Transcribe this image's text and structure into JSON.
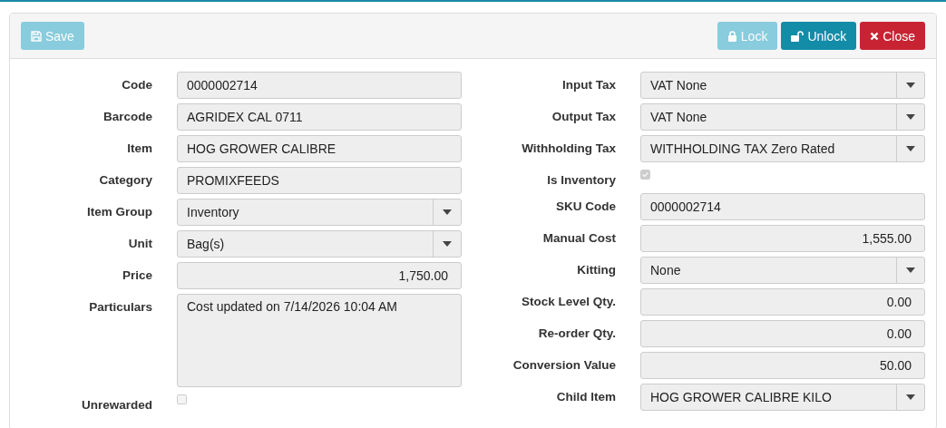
{
  "toolbar": {
    "left_buttons": [
      {
        "label": "Save",
        "kind": "save",
        "disabled": true
      }
    ],
    "right_buttons": [
      {
        "label": "Lock",
        "kind": "lock",
        "disabled": true
      },
      {
        "label": "Unlock",
        "kind": "unlock",
        "disabled": false
      },
      {
        "label": "Close",
        "kind": "close",
        "disabled": false
      }
    ]
  },
  "left_fields": [
    {
      "label": "Code",
      "kind": "text",
      "value": "0000002714"
    },
    {
      "label": "Barcode",
      "kind": "text",
      "value": "AGRIDEX CAL 0711"
    },
    {
      "label": "Item",
      "kind": "text",
      "value": "HOG GROWER CALIBRE"
    },
    {
      "label": "Category",
      "kind": "text",
      "value": "PROMIXFEEDS"
    },
    {
      "label": "Item Group",
      "kind": "select",
      "value": "Inventory"
    },
    {
      "label": "Unit",
      "kind": "select",
      "value": "Bag(s)"
    },
    {
      "label": "Price",
      "kind": "number",
      "value": "1,750.00"
    },
    {
      "label": "Particulars",
      "kind": "textarea",
      "value": "Cost updated on 7/14/2026 10:04 AM"
    },
    {
      "label": "Unrewarded",
      "kind": "checkbox",
      "checked": false
    }
  ],
  "right_fields": [
    {
      "label": "Input Tax",
      "kind": "select",
      "value": "VAT None"
    },
    {
      "label": "Output Tax",
      "kind": "select",
      "value": "VAT None"
    },
    {
      "label": "Withholding Tax",
      "kind": "select",
      "value": "WITHHOLDING TAX Zero Rated"
    },
    {
      "label": "Is Inventory",
      "kind": "checkbox",
      "checked": true
    },
    {
      "label": "SKU Code",
      "kind": "text",
      "value": "0000002714"
    },
    {
      "label": "Manual Cost",
      "kind": "number",
      "value": "1,555.00"
    },
    {
      "label": "Kitting",
      "kind": "select",
      "value": "None"
    },
    {
      "label": "Stock Level Qty.",
      "kind": "number",
      "value": "0.00"
    },
    {
      "label": "Re-order Qty.",
      "kind": "number",
      "value": "0.00"
    },
    {
      "label": "Conversion Value",
      "kind": "number",
      "value": "50.00"
    },
    {
      "label": "Child Item",
      "kind": "select",
      "value": "HOG GROWER CALIBRE KILO"
    }
  ]
}
